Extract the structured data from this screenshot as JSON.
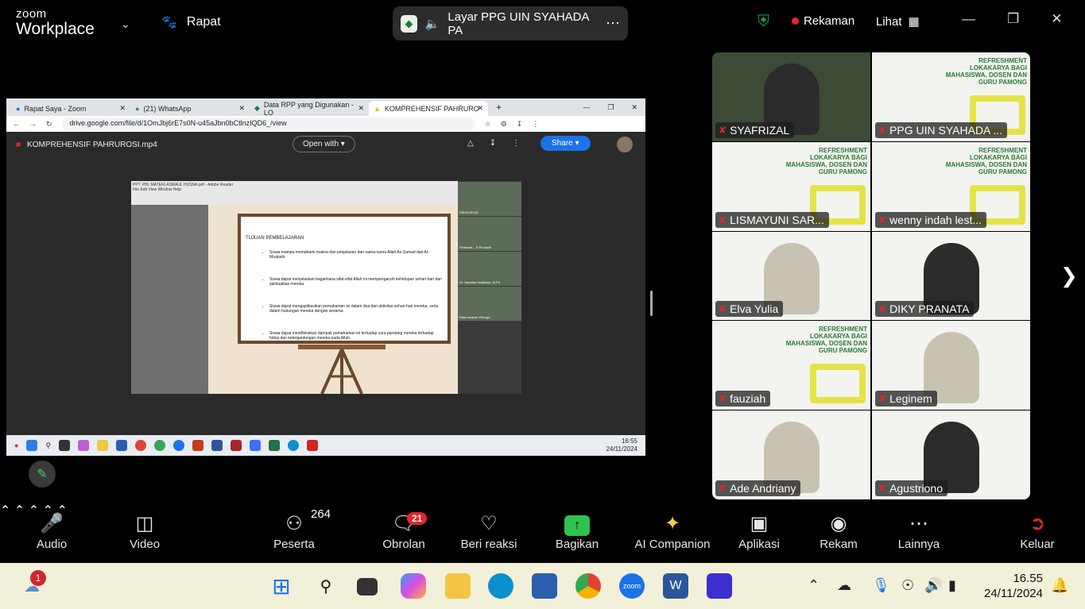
{
  "top": {
    "brand_line1": "zoom",
    "brand_line2": "Workplace",
    "meeting_label": "Rapat",
    "share_title": "Layar PPG UIN SYAHADA PA",
    "recording_label": "Rekaman",
    "view_label": "Lihat"
  },
  "browser": {
    "tabs": [
      {
        "label": "Rapat Saya - Zoom"
      },
      {
        "label": "(21) WhatsApp"
      },
      {
        "label": "Data RPP yang Digunakan - LO"
      },
      {
        "label": "KOMPREHENSIF PAHRURO"
      }
    ],
    "url": "drive.google.com/file/d/1OmJbj6rE7s0N-u45aJbn0bCtlnzIQD6_/view",
    "file_name": "KOMPREHENSIF PAHRUROSI.mp4",
    "open_with": "Open with",
    "share": "Share"
  },
  "slide": {
    "reader_title": "PPT. PBL MATERI ASMAUL HUSNA.pdf - Adobe Reader",
    "reader_menu": "File  Edit  View  Window  Help",
    "heading": "TUJUAN PEMBELAJARAN",
    "bullets": [
      "Siswa mampu memahami makna dan penjelasan dari nama-nama Allah As-Samad dan Al-Muqtadir.",
      "Siswa dapat menjelaskan bagaimana sifat-sifat Allah ini mempengaruhi kehidupan sehari-hari dan spiritualitas mereka.",
      "Siswa dapat mengaplikasikan pemahaman ini dalam doa dan aktivitas sehari-hari mereka, serta dalam hubungan mereka dengan sesama.",
      "Siswa dapat merefleksikan dampak pemahaman ini terhadap cara pandang mereka terhadap hidup dan ketergantungan mereka pada Allah."
    ],
    "gallery_names": [
      "PAHRUROSI",
      "Firdawati.., S.Pd.Kadir",
      "Dr. Hamdan Hasibuan, M.Pd",
      "Rida Amaliah Ritonga"
    ]
  },
  "inner_taskbar": {
    "time": "16:55",
    "date": "24/11/2024"
  },
  "participants": [
    {
      "name": "SYAFRIZAL",
      "kind": "cam"
    },
    {
      "name": "PPG UIN SYAHADA ...",
      "kind": "banner"
    },
    {
      "name": "LISMAYUNI SAR...",
      "kind": "banner"
    },
    {
      "name": "wenny indah lest...",
      "kind": "banner"
    },
    {
      "name": "Elva Yulia",
      "kind": "person-hij"
    },
    {
      "name": "DIKY PRANATA",
      "kind": "person"
    },
    {
      "name": "fauziah",
      "kind": "banner"
    },
    {
      "name": "Leginem",
      "kind": "person-hij"
    },
    {
      "name": "Ade Andriany",
      "kind": "person-hij"
    },
    {
      "name": "Agustriono",
      "kind": "person"
    }
  ],
  "banner_text": {
    "line1": "REFRESHMENT",
    "line2": "LOKAKARYA BAGI",
    "line3": "MAHASISWA, DOSEN DAN",
    "line4": "GURU PAMONG"
  },
  "controls": {
    "audio": "Audio",
    "video": "Video",
    "participants": "Peserta",
    "participants_count": "264",
    "chat": "Obrolan",
    "chat_badge": "21",
    "react": "Beri reaksi",
    "share": "Bagikan",
    "ai": "AI Companion",
    "apps": "Aplikasi",
    "record": "Rekam",
    "more": "Lainnya",
    "leave": "Keluar"
  },
  "taskbar": {
    "weather_badge": "1",
    "time": "16.55",
    "date": "24/11/2024"
  },
  "colors": {
    "accent_green": "#2ec24f",
    "alert_red": "#e5262d",
    "zoom_blue": "#1a73e8"
  }
}
